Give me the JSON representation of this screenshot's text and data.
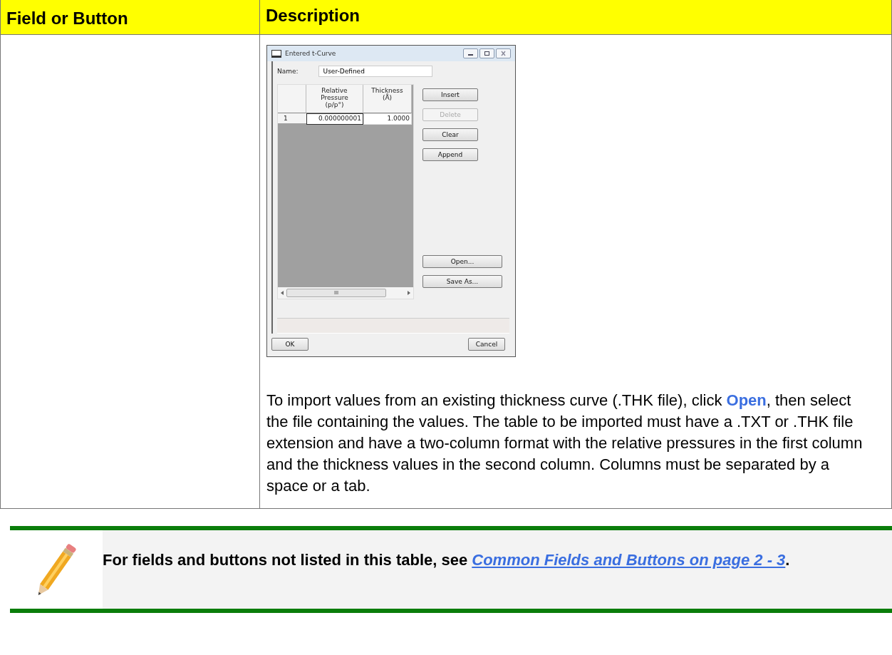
{
  "table": {
    "columns": [
      "Field or Button",
      "Description"
    ],
    "rows": [
      {
        "field": "",
        "dialog": {
          "title": "Entered t-Curve",
          "name_label": "Name:",
          "name_value": "User-Defined",
          "grid_columns": [
            "Relative\nPressure\n(p/p°)",
            "Thickness\n(Å)"
          ],
          "grid_rows": [
            {
              "index": "1",
              "cells": [
                "0.000000001",
                "1.0000"
              ]
            }
          ],
          "scroll_thumb": "III",
          "side_buttons": [
            {
              "label": "Insert",
              "disabled": false
            },
            {
              "label": "Delete",
              "disabled": true
            },
            {
              "label": "Clear",
              "disabled": false
            },
            {
              "label": "Append",
              "disabled": false
            }
          ],
          "file_buttons": [
            {
              "label": "Open...",
              "disabled": false
            },
            {
              "label": "Save As...",
              "disabled": false
            }
          ],
          "ok": "OK",
          "cancel": "Cancel"
        },
        "description": "To import values from an existing thickness curve (.THK file), click **Open**, then select the file containing the values. The table to be imported must have a .TXT or .THK file extension and have a two-column format with the relative pressures in the first column and the thickness values in the second column. Columns must be separated by a space or a tab."
      }
    ]
  },
  "note": {
    "text": "For fields and buttons not listed in this table, see",
    "link": "Common Fields and Buttons on page 2 - 3",
    "end": "."
  }
}
